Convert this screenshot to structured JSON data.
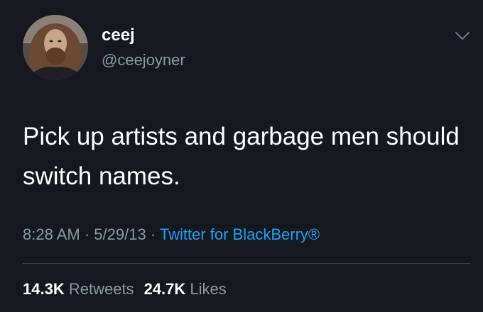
{
  "author": {
    "display_name": "ceej",
    "handle": "@ceejoyner"
  },
  "tweet": {
    "text": "Pick up artists and garbage men should switch names.",
    "time": "8:28 AM",
    "date": "5/29/13",
    "separator": "·",
    "source": "Twitter for BlackBerry®"
  },
  "stats": {
    "retweets_count": "14.3K",
    "retweets_label": "Retweets",
    "likes_count": "24.7K",
    "likes_label": "Likes"
  },
  "colors": {
    "background": "#15181f",
    "secondary_text": "#8899a6",
    "link": "#1da1f2",
    "divider": "#38444d"
  },
  "icons": {
    "menu": "chevron-down-icon",
    "avatar": "profile-photo"
  }
}
